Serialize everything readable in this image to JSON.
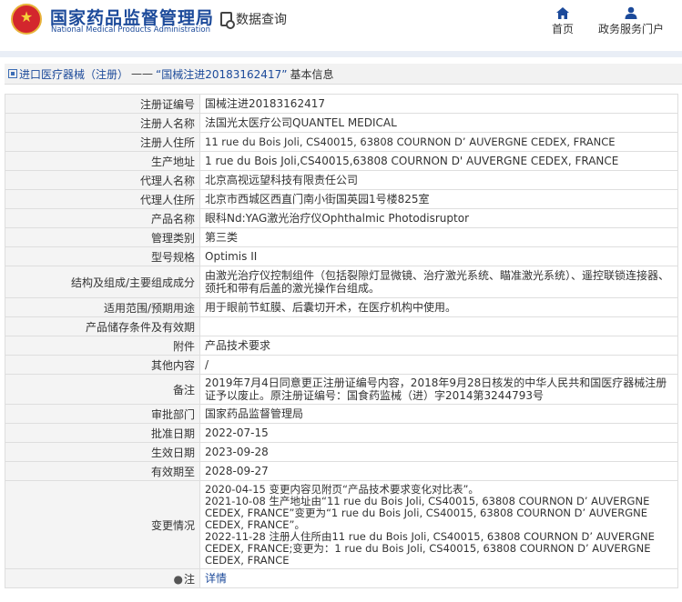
{
  "header": {
    "site_name_cn": "国家药品监督管理局",
    "site_name_en": "National Medical Products Administration",
    "data_query_label": "数据查询",
    "nav": {
      "home": "首页",
      "services": "政务服务门户"
    }
  },
  "breadcrumb": {
    "link": "进口医疗器械（注册）",
    "separator": "——",
    "current": "“国械注进20183162417”",
    "suffix": "基本信息"
  },
  "details": {
    "rows": [
      {
        "label": "注册证编号",
        "value": "国械注进20183162417"
      },
      {
        "label": "注册人名称",
        "value": "法国光太医疗公司QUANTEL MEDICAL"
      },
      {
        "label": "注册人住所",
        "value": "11 rue du Bois Joli, CS40015, 63808 COURNON D’ AUVERGNE CEDEX, FRANCE"
      },
      {
        "label": "生产地址",
        "value": "1 rue du Bois Joli,CS40015,63808 COURNON D' AUVERGNE CEDEX, FRANCE"
      },
      {
        "label": "代理人名称",
        "value": "北京高视远望科技有限责任公司"
      },
      {
        "label": "代理人住所",
        "value": "北京市西城区西直门南小街国英园1号楼825室"
      },
      {
        "label": "产品名称",
        "value": "眼科Nd:YAG激光治疗仪Ophthalmic Photodisruptor"
      },
      {
        "label": "管理类别",
        "value": "第三类"
      },
      {
        "label": "型号规格",
        "value": "Optimis II"
      },
      {
        "label": "结构及组成/主要组成成分",
        "value": "由激光治疗仪控制组件（包括裂隙灯显微镜、治疗激光系统、瞄准激光系统）、遥控联锁连接器、颈托和带有后盖的激光操作台组成。"
      },
      {
        "label": "适用范围/预期用途",
        "value": "用于眼前节虹膜、后囊切开术，在医疗机构中使用。"
      },
      {
        "label": "产品储存条件及有效期",
        "value": ""
      },
      {
        "label": "附件",
        "value": "产品技术要求"
      },
      {
        "label": "其他内容",
        "value": "/"
      },
      {
        "label": "备注",
        "value": "2019年7月4日同意更正注册证编号内容，2018年9月28日核发的中华人民共和国医疗器械注册证予以废止。原注册证编号：国食药监械（进）字2014第3244793号"
      },
      {
        "label": "审批部门",
        "value": "国家药品监督管理局"
      },
      {
        "label": "批准日期",
        "value": "2022-07-15"
      },
      {
        "label": "生效日期",
        "value": "2023-09-28"
      },
      {
        "label": "有效期至",
        "value": "2028-09-27"
      },
      {
        "label": "变更情况",
        "value": ""
      },
      {
        "label": "注",
        "value": "详情"
      }
    ],
    "changes": [
      "2020-04-15 变更内容见附页“产品技术要求变化对比表”。",
      "2021-10-08 生产地址由“11 rue du Bois Joli, CS40015, 63808 COURNON D’ AUVERGNE CEDEX, FRANCE”变更为“1 rue du Bois Joli, CS40015, 63808 COURNON D’ AUVERGNE CEDEX, FRANCE”。",
      "2022-11-28 注册人住所由11 rue du Bois Joli, CS40015, 63808 COURNON D’ AUVERGNE CEDEX, FRANCE;变更为：1 rue du Bois Joli, CS40015, 63808 COURNON D’ AUVERGNE CEDEX, FRANCE"
    ]
  }
}
